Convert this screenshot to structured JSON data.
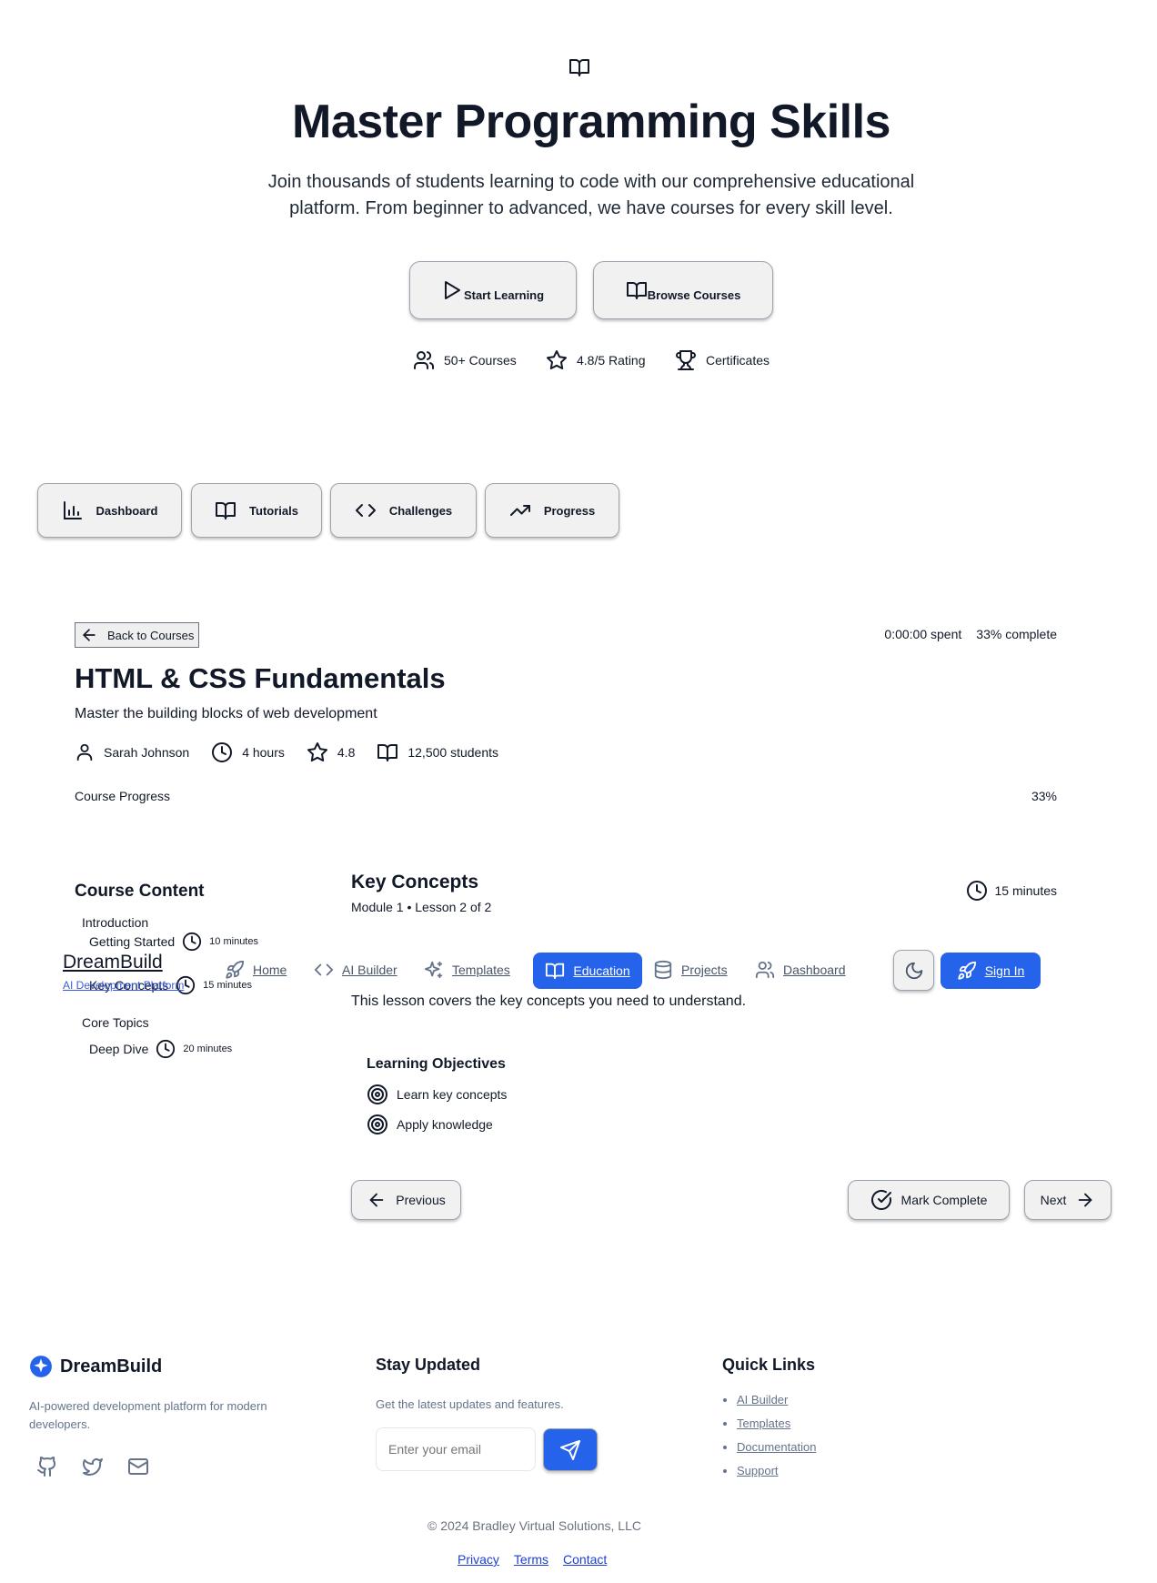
{
  "hero": {
    "icon": "book-open-icon",
    "title": "Master Programming Skills",
    "subtitle": "Join thousands of students learning to code with our comprehensive educational platform. From beginner to advanced, we have courses for every skill level.",
    "primary_button": "Start Learning",
    "secondary_button": "Browse Courses",
    "stats": [
      {
        "icon": "users-icon",
        "label": "50+ Courses"
      },
      {
        "icon": "star-icon",
        "label": "4.8/5 Rating"
      },
      {
        "icon": "trophy-icon",
        "label": "Certificates"
      }
    ]
  },
  "tabs": [
    {
      "icon": "bar-chart-icon",
      "label": "Dashboard"
    },
    {
      "icon": "book-open-icon",
      "label": "Tutorials"
    },
    {
      "icon": "code-icon",
      "label": "Challenges"
    },
    {
      "icon": "trending-up-icon",
      "label": "Progress"
    }
  ],
  "course": {
    "back_label": "Back to Courses",
    "time_spent": "0:00:00 spent",
    "complete": "33% complete",
    "title": "HTML & CSS Fundamentals",
    "subtitle": "Master the building blocks of web development",
    "instructor": "Sarah Johnson",
    "duration": "4 hours",
    "rating": "4.8",
    "students": "12,500 students",
    "progress_label": "Course Progress",
    "progress_value": "33%",
    "progress_fraction": 0.33
  },
  "sidebar": {
    "title": "Course Content",
    "modules": [
      {
        "title": "Introduction",
        "lessons": [
          {
            "title": "Getting Started",
            "duration": "10 minutes"
          },
          {
            "title": "Key Concepts",
            "duration": "15 minutes"
          }
        ]
      },
      {
        "title": "Core Topics",
        "lessons": [
          {
            "title": "Deep Dive",
            "duration": "20 minutes"
          }
        ]
      }
    ]
  },
  "lesson": {
    "title": "Key Concepts",
    "subtitle": "Module 1 • Lesson 2 of 2",
    "duration": "15 minutes",
    "body": "This lesson covers the key concepts you need to understand.",
    "objectives_title": "Learning Objectives",
    "objectives": [
      "Learn key concepts",
      "Apply knowledge"
    ],
    "previous": "Previous",
    "mark_complete": "Mark Complete",
    "next": "Next"
  },
  "navbar": {
    "brand": "DreamBuild",
    "tagline": "AI Development Platform",
    "links": [
      {
        "icon": "rocket-icon",
        "label": "Home"
      },
      {
        "icon": "code-icon",
        "label": "AI Builder"
      },
      {
        "icon": "sparkles-icon",
        "label": "Templates"
      },
      {
        "icon": "book-open-icon",
        "label": "Education"
      },
      {
        "icon": "database-icon",
        "label": "Projects"
      },
      {
        "icon": "users-icon",
        "label": "Dashboard"
      }
    ],
    "active": "Education",
    "theme_icon": "moon-icon",
    "sign_in": "Sign In",
    "accent": "#2563eb"
  },
  "footer": {
    "brand": "DreamBuild",
    "description": "AI-powered development platform for modern developers.",
    "social": [
      "github-icon",
      "twitter-icon",
      "mail-icon"
    ],
    "newsletter_title": "Stay Updated",
    "newsletter_text": "Get the latest updates and features.",
    "email_placeholder": "Enter your email",
    "quick_links_title": "Quick Links",
    "quick_links": [
      "AI Builder",
      "Templates",
      "Documentation",
      "Support"
    ],
    "copyright": "© 2024 Bradley Virtual Solutions, LLC",
    "legal": [
      "Privacy",
      "Terms",
      "Contact"
    ]
  }
}
